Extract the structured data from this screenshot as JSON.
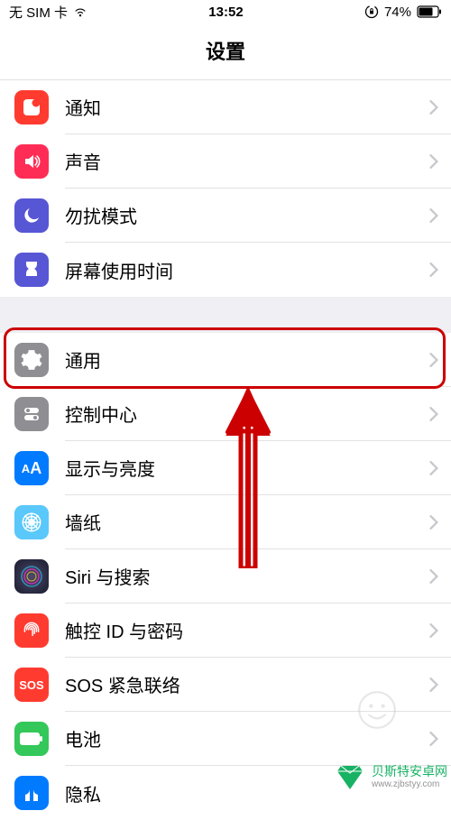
{
  "status": {
    "carrier": "无 SIM 卡",
    "time": "13:52",
    "battery": "74%"
  },
  "header": {
    "title": "设置"
  },
  "rows": {
    "notifications": "通知",
    "sound": "声音",
    "dnd": "勿扰模式",
    "screentime": "屏幕使用时间",
    "general": "通用",
    "controlcenter": "控制中心",
    "display": "显示与亮度",
    "wallpaper": "墙纸",
    "siri": "Siri 与搜索",
    "touchid": "触控 ID 与密码",
    "sos": "SOS 紧急联络",
    "battery": "电池",
    "privacy": "隐私"
  },
  "sos_label": "SOS",
  "watermark": {
    "line1": "贝斯特安卓网",
    "line2": "www.zjbstyy.com"
  },
  "colors": {
    "red": "#ff3b30",
    "purple": "#5756d5",
    "gray": "#8e8e93",
    "blue": "#007aff",
    "cyan": "#5ac8fa",
    "green": "#34c759",
    "hand": "#007aff"
  }
}
